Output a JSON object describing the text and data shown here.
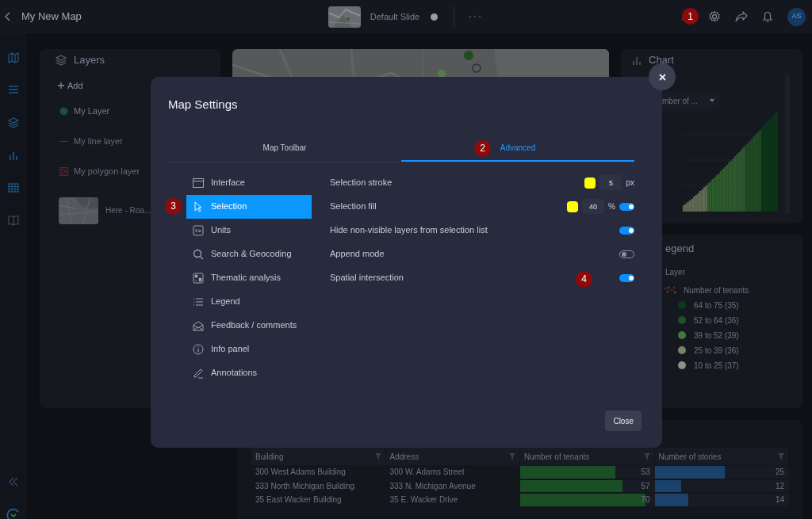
{
  "header": {
    "title": "My New Map",
    "slide": "Default Slide",
    "settings_marker": "1",
    "avatar": "AS"
  },
  "layers": {
    "title": "Layers",
    "add": "Add",
    "items": [
      {
        "kind": "point",
        "name": "My Layer"
      },
      {
        "kind": "line",
        "name": "My line layer"
      },
      {
        "kind": "polygon",
        "name": "My polygon layer"
      },
      {
        "kind": "basemap",
        "name": "Here - Roa..."
      }
    ]
  },
  "chart": {
    "title": "Chart",
    "dropdown": "mber of ..."
  },
  "legend": {
    "title": "egend",
    "layer": "Layer",
    "field": "Number of tenants",
    "classes": [
      {
        "label": "64 to 75 (35)",
        "color": "#0b3a1b"
      },
      {
        "label": "52 to 64 (36)",
        "color": "#1f5326"
      },
      {
        "label": "39 to 52 (39)",
        "color": "#44773a"
      },
      {
        "label": "25 to 39 (36)",
        "color": "#77836a"
      },
      {
        "label": "10 to 25 (37)",
        "color": "#8e9088"
      }
    ]
  },
  "table": {
    "columns": [
      "Building",
      "Address",
      "Number of tenants",
      "Number of stories"
    ],
    "rows": [
      {
        "building": "300 West Adams Building",
        "address": "300 W. Adams Street",
        "tenants": {
          "value": "53",
          "level": 0.71
        },
        "stories": {
          "value": "25",
          "level": 0.52
        }
      },
      {
        "building": "333 North Michigan Building",
        "address": "333 N. Michigan Avenue",
        "tenants": {
          "value": "57",
          "level": 0.76
        },
        "stories": {
          "value": "12",
          "level": 0.2
        }
      },
      {
        "building": "35 East Wacker Building",
        "address": "35 E. Wacker Drive",
        "tenants": {
          "value": "70",
          "level": 0.93
        },
        "stories": {
          "value": "14",
          "level": 0.25
        }
      }
    ]
  },
  "dialog": {
    "title": "Map Settings",
    "tabs": [
      {
        "label": "Map Toolbar",
        "selected": false
      },
      {
        "label": "Advanced",
        "selected": true,
        "marker": "2"
      }
    ],
    "nav": [
      {
        "kind": "window",
        "label": "Interface",
        "selected": false
      },
      {
        "kind": "cursor",
        "label": "Selection",
        "selected": true,
        "marker": "3"
      },
      {
        "kind": "units",
        "label": "Units",
        "selected": false
      },
      {
        "kind": "search",
        "label": "Search & Geocoding",
        "selected": false
      },
      {
        "kind": "thematic",
        "label": "Thematic analysis",
        "selected": false
      },
      {
        "kind": "list",
        "label": "Legend",
        "selected": false
      },
      {
        "kind": "mail",
        "label": "Feedback / comments",
        "selected": false
      },
      {
        "kind": "info",
        "label": "Info panel",
        "selected": false
      },
      {
        "kind": "pen",
        "label": "Annotations",
        "selected": false
      }
    ],
    "settings": [
      {
        "label": "Selection stroke",
        "color": "#ffff00",
        "value": "5",
        "unit": "px"
      },
      {
        "label": "Selection fill",
        "color": "#ffff00",
        "value": "40",
        "unit": "%",
        "on": true
      },
      {
        "label": "Hide non-visible layers from selection list",
        "on": true
      },
      {
        "label": "Append mode",
        "on": false
      },
      {
        "label": "Spatial intersection",
        "on": true,
        "marker": "4"
      }
    ],
    "close": "Close"
  }
}
